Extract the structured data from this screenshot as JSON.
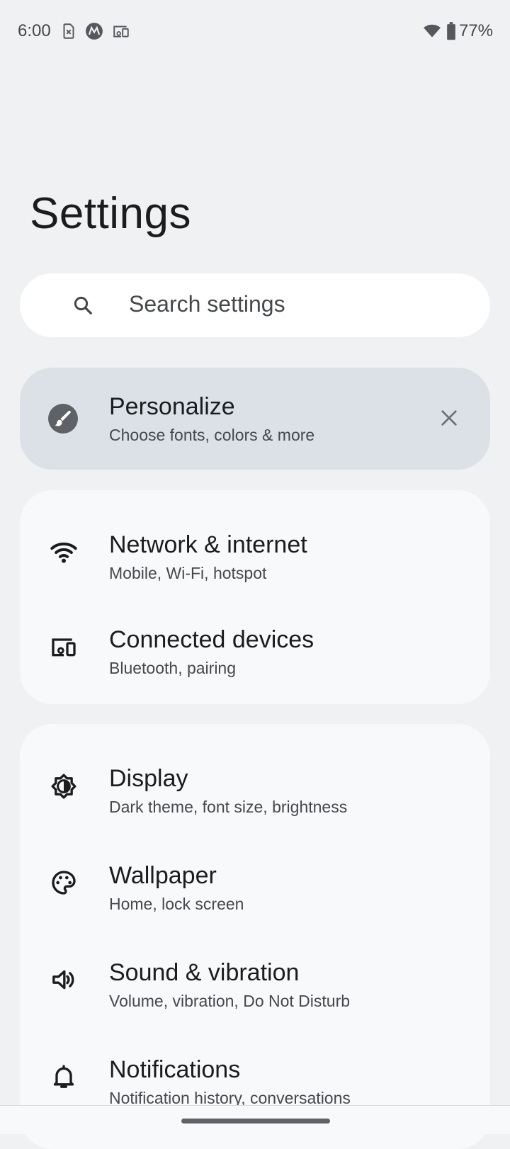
{
  "status_bar": {
    "time": "6:00",
    "left_icons": [
      "sim-error-icon",
      "motorola-icon",
      "cast-devices-icon"
    ],
    "right_icons": [
      "wifi-icon",
      "battery-icon"
    ],
    "battery_percent": "77%"
  },
  "page": {
    "title": "Settings"
  },
  "search": {
    "placeholder": "Search settings",
    "icon": "search-icon"
  },
  "suggestion": {
    "title": "Personalize",
    "subtitle": "Choose fonts, colors & more",
    "icon": "brush-icon",
    "dismiss_icon": "close-icon"
  },
  "groups": [
    {
      "items": [
        {
          "title": "Network & internet",
          "subtitle": "Mobile, Wi-Fi, hotspot",
          "icon": "wifi-icon"
        },
        {
          "title": "Connected devices",
          "subtitle": "Bluetooth, pairing",
          "icon": "devices-icon"
        }
      ]
    },
    {
      "items": [
        {
          "title": "Display",
          "subtitle": "Dark theme, font size, brightness",
          "icon": "brightness-icon"
        },
        {
          "title": "Wallpaper",
          "subtitle": "Home, lock screen",
          "icon": "palette-icon"
        },
        {
          "title": "Sound & vibration",
          "subtitle": "Volume, vibration, Do Not Disturb",
          "icon": "volume-icon"
        },
        {
          "title": "Notifications",
          "subtitle": "Notification history, conversations",
          "icon": "bell-icon"
        }
      ]
    }
  ],
  "colors": {
    "background": "#eff1f3",
    "card": "#f8f9fb",
    "suggestion_card": "#dbe1e6",
    "text_primary": "#1b1c1e",
    "text_secondary": "#45484c"
  }
}
